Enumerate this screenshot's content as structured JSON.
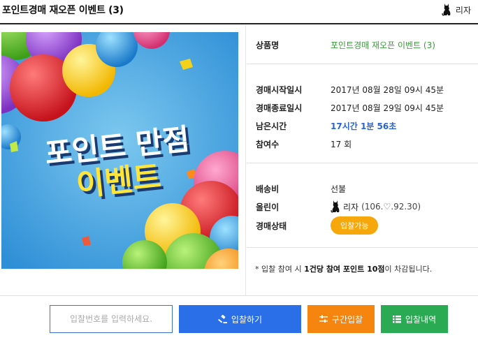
{
  "header": {
    "title": "포인트경매 재오픈 이벤트 (3)",
    "seller_name": "리자"
  },
  "banner": {
    "line1": "포인트 만점",
    "line2": "이벤트"
  },
  "details": {
    "product_label": "상품명",
    "product_value": "포인트경매 재오픈 이벤트 (3)",
    "start_label": "경매시작일시",
    "start_value": "2017년 08월 28일 09시 45분",
    "end_label": "경매종료일시",
    "end_value": "2017년 08월 29일 09시 45분",
    "remaining_label": "남은시간",
    "remaining_value": "17시간 1분 56초",
    "participants_label": "참여수",
    "participants_value": "17 회",
    "shipping_label": "배송비",
    "shipping_value": "선불",
    "seller_label": "올린이",
    "seller_name": "리자",
    "seller_score": "(106.♡.92.30)",
    "status_label": "경매상태",
    "status_value": "입찰가능"
  },
  "notice": {
    "prefix": "* 입찰 참여 시 ",
    "highlight": "1건당 참여 포인트 10점",
    "suffix": "이 차감됩니다."
  },
  "actions": {
    "input_placeholder": "입찰번호를 입력하세요.",
    "bid_label": "입찰하기",
    "range_label": "구간입찰",
    "history_label": "입찰내역"
  },
  "colors": {
    "bid_button": "#2a6ee8",
    "range_button": "#f5850f",
    "history_button": "#2aaa52",
    "status_pill": "#f6a70c",
    "remaining_time": "#2563d6",
    "product_value": "#3a9a3a"
  },
  "icons": {
    "seller": "cat-silhouette-icon",
    "bid": "gavel-icon",
    "range": "sliders-icon",
    "history": "list-icon"
  }
}
